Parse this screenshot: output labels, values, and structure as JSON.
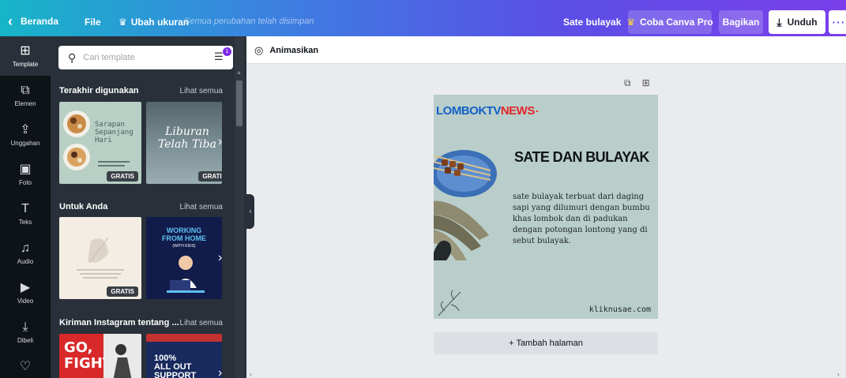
{
  "topbar": {
    "back_label": "Beranda",
    "file_label": "File",
    "resize_label": "Ubah ukuran",
    "saved_status": "Semua perubahan telah disimpan",
    "design_title": "Sate bulayak",
    "pro_label": "Coba Canva Pro",
    "share_label": "Bagikan",
    "download_label": "Unduh",
    "more_label": "···"
  },
  "rail": {
    "items": [
      {
        "label": "Template",
        "icon": "template-icon",
        "glyph": "⊞"
      },
      {
        "label": "Elemen",
        "icon": "elements-icon",
        "glyph": "⧉"
      },
      {
        "label": "Unggahan",
        "icon": "upload-icon",
        "glyph": "⇪"
      },
      {
        "label": "Foto",
        "icon": "photo-icon",
        "glyph": "▣"
      },
      {
        "label": "Teks",
        "icon": "text-icon",
        "glyph": "T"
      },
      {
        "label": "Audio",
        "icon": "audio-icon",
        "glyph": "♫"
      },
      {
        "label": "Video",
        "icon": "video-icon",
        "glyph": "▶"
      },
      {
        "label": "Dibeli",
        "icon": "purchased-icon",
        "glyph": "⤓"
      },
      {
        "label": "",
        "icon": "heart-icon",
        "glyph": "♡"
      }
    ]
  },
  "panel": {
    "search_placeholder": "Cari template",
    "filter_badge": "1",
    "sections": [
      {
        "title": "Terakhir digunakan",
        "see_all": "Lihat semua"
      },
      {
        "title": "Untuk Anda",
        "see_all": "Lihat semua"
      },
      {
        "title": "Kiriman Instagram tentang ...",
        "see_all": "Lihat semua"
      }
    ],
    "thumbs": {
      "t1_text": "Sarapan\nSepanjang\nHari",
      "t1_badge": "GRATIS",
      "t2_text": "Liburan Telah Tiba",
      "t2_badge": "GRATIS",
      "t3_badge": "GRATIS",
      "t4_line1": "WORKING",
      "t4_line2": "FROM HOME",
      "t4_line3": "(WITH KIDS)",
      "t5_text": "GO, FIGHT,",
      "t7_line1": "100%",
      "t7_line2": "ALL OUT",
      "t7_line3": "SUPPORT"
    }
  },
  "editbar": {
    "animate_label": "Animasikan"
  },
  "design": {
    "logo_part1": "LOMBOKTV",
    "logo_part2": "NEWS",
    "title": "SATE DAN BULAYAK",
    "body": "sate bulayak terbuat dari daging sapi yang dilumuri dengan bumbu khas lombok dan di padukan dengan potongan lontong yang di sebut bulayak.",
    "url": "kliknusae.com"
  },
  "add_page_label": "+ Tambah halaman",
  "colors": {
    "accent": "#7d2ae8",
    "panel_bg": "#293039",
    "rail_bg": "#0e1318",
    "design_bg": "#b9ceca"
  }
}
